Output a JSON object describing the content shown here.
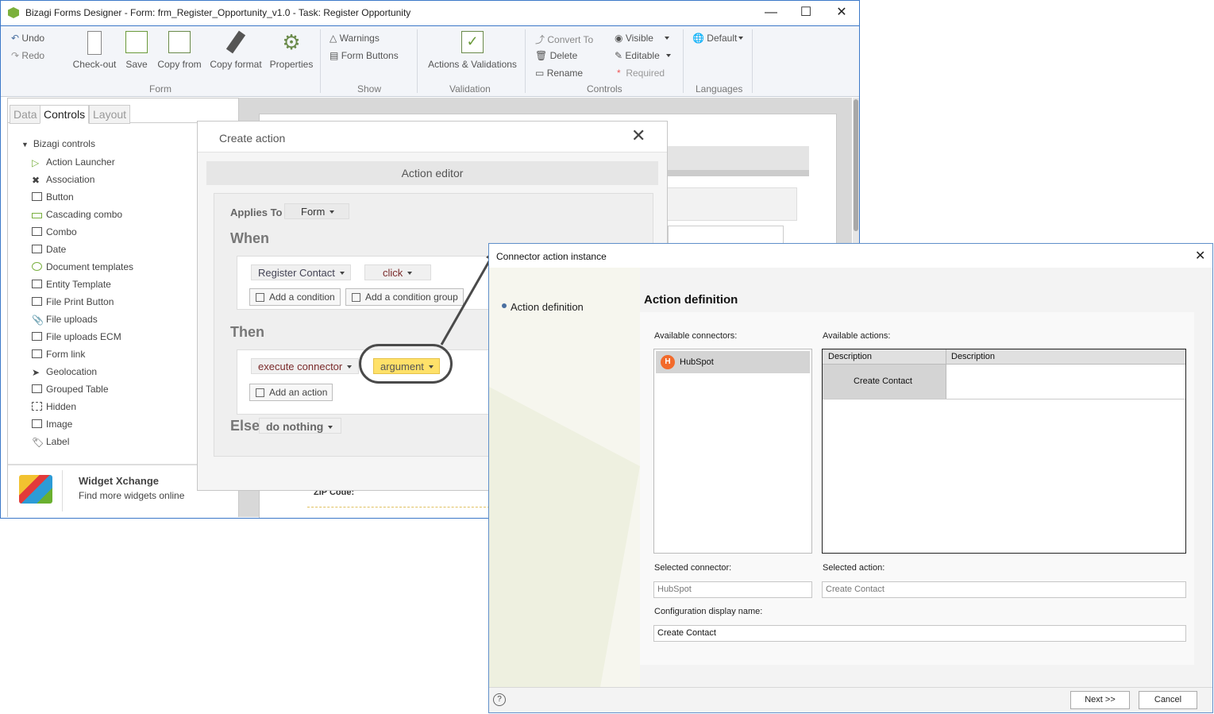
{
  "window": {
    "title": "Bizagi Forms Designer  - Form: frm_Register_Opportunity_v1.0 - Task:  Register Opportunity",
    "minimize": "—",
    "maximize": "☐",
    "close": "✕"
  },
  "ribbon": {
    "undo": "Undo",
    "redo": "Redo",
    "checkout": "Check-out",
    "save": "Save",
    "copy_from": "Copy from",
    "copy_format": "Copy format",
    "properties": "Properties",
    "group_form": "Form",
    "warnings": "Warnings",
    "form_buttons": "Form Buttons",
    "group_show": "Show",
    "actions_validations": "Actions & Validations",
    "group_validation": "Validation",
    "convert_to": "Convert To",
    "delete": "Delete",
    "rename": "Rename",
    "visible": "Visible",
    "editable": "Editable",
    "required": "Required",
    "group_controls": "Controls",
    "default_lang": "Default",
    "group_languages": "Languages"
  },
  "left_panel": {
    "tabs": [
      "Data",
      "Controls",
      "Layout"
    ],
    "root": "Bizagi controls",
    "items": [
      "Action Launcher",
      "Association",
      "Button",
      "Cascading combo",
      "Combo",
      "Date",
      "Document templates",
      "Entity Template",
      "File Print Button",
      "File uploads",
      "File uploads ECM",
      "Form link",
      "Geolocation",
      "Grouped Table",
      "Hidden",
      "Image",
      "Label"
    ],
    "widget_title": "Widget Xchange",
    "widget_subtitle": "Find more widgets online"
  },
  "form_sheet": {
    "zip_label": "ZIP Code:"
  },
  "create_action": {
    "title": "Create action",
    "close": "✕",
    "editor_header": "Action editor",
    "applies_to_label": "Applies To",
    "applies_to_value": "Form",
    "when_label": "When",
    "when_control": "Register Contact",
    "when_event": "click",
    "add_condition": "Add a condition",
    "add_condition_group": "Add a condition group",
    "then_label": "Then",
    "then_action": "execute connector",
    "then_argument": "argument",
    "add_action": "Add an action",
    "else_label": "Else",
    "else_value": "do nothing"
  },
  "connector_dialog": {
    "title": "Connector action instance",
    "close": "✕",
    "step": "Action definition",
    "heading": "Action definition",
    "available_connectors_label": "Available connectors:",
    "connectors": [
      "HubSpot"
    ],
    "available_actions_label": "Available actions:",
    "actions_headers": [
      "Description",
      "Description"
    ],
    "actions_rows": [
      "Create Contact"
    ],
    "selected_connector_label": "Selected connector:",
    "selected_connector_value": "HubSpot",
    "selected_action_label": "Selected action:",
    "selected_action_value": "Create Contact",
    "config_name_label": "Configuration display name:",
    "config_name_value": "Create Contact",
    "next_button": "Next >>",
    "cancel_button": "Cancel",
    "help": "?"
  },
  "colors": {
    "accent_blue": "#3c78c8",
    "highlight_yellow": "#ffe169",
    "hubspot_orange": "#f26a2b"
  }
}
